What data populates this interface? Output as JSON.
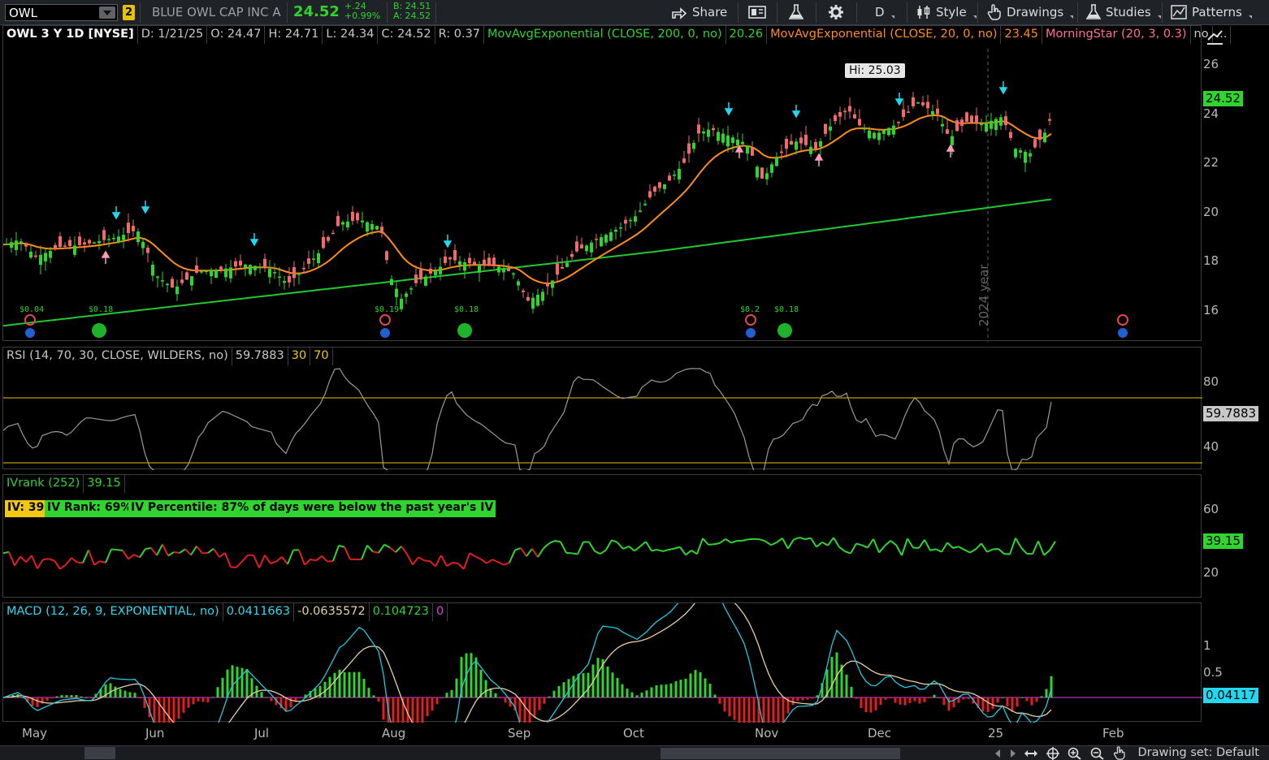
{
  "toolbar": {
    "symbol": "OWL",
    "link_number": "2",
    "company_name": "BLUE OWL CAP INC A",
    "last_price": "24.52",
    "change": "+.24",
    "change_pct": "+0.99%",
    "bid": "B: 24.51",
    "ask": "A: 24.52",
    "share_label": "Share",
    "aggregation": "D",
    "style_label": "Style",
    "drawings_label": "Drawings",
    "studies_label": "Studies",
    "patterns_label": "Patterns"
  },
  "price_panel": {
    "title": "OWL 3 Y 1D [NYSE]",
    "date": "D: 1/21/25",
    "open": "O: 24.47",
    "high": "H: 24.71",
    "low": "L: 24.34",
    "close": "C: 24.52",
    "range": "R: 0.37",
    "ema200_label": "MovAvgExponential (CLOSE, 200, 0, no)",
    "ema200_value": "20.26",
    "ema20_label": "MovAvgExponential (CLOSE, 20, 0, no)",
    "ema20_value": "23.45",
    "morningstar_label": "MorningStar (20, 3, 0.3)",
    "morningstar_value": "no",
    "more": "...",
    "hi_label": "Hi: 25.03",
    "price_tag": "24.52",
    "year_marker": "2024 year",
    "y_ticks": [
      "26",
      "24",
      "22",
      "20",
      "18",
      "16"
    ],
    "dividends": [
      "$0.04",
      "$0.18",
      "$0.19",
      "$0.18",
      "$0.2",
      "$0.18"
    ]
  },
  "rsi_panel": {
    "label": "RSI (14, 70, 30, CLOSE, WILDERS, no)",
    "value": "59.7883",
    "oversold": "30",
    "overbought": "70",
    "y_ticks": [
      "80",
      "40"
    ],
    "tag": "59.7883"
  },
  "iv_panel": {
    "label": "IVrank (252)",
    "value": "39.15",
    "iv_box": "IV: 39",
    "rank_box": "IV Rank: 69%",
    "pct_box": "IV Percentile: 87% of days were below the past year's IV",
    "y_ticks": [
      "60",
      "20"
    ],
    "tag": "39.15"
  },
  "macd_panel": {
    "label": "MACD (12, 26, 9, EXPONENTIAL, no)",
    "value": "0.0411663",
    "avg": "-0.0635572",
    "diff": "0.104723",
    "zero": "0",
    "y_ticks": [
      "1",
      "0.5"
    ],
    "tag": "0.04117"
  },
  "x_axis": {
    "months": [
      "May",
      "Jun",
      "Jul",
      "Aug",
      "Sep",
      "Oct",
      "Nov",
      "Dec",
      "25",
      "Feb"
    ]
  },
  "status": {
    "drawing_set": "Drawing set: Default"
  },
  "colors": {
    "up": "#2fd42f",
    "down": "#f06a6a",
    "ema20": "#ff8c1a",
    "ema200": "#22c832",
    "rsi_line": "#9a9a9a",
    "macd": "#22c8e0",
    "macd_avg": "#e8d0a0",
    "guide_yellow": "#e8c200"
  }
}
